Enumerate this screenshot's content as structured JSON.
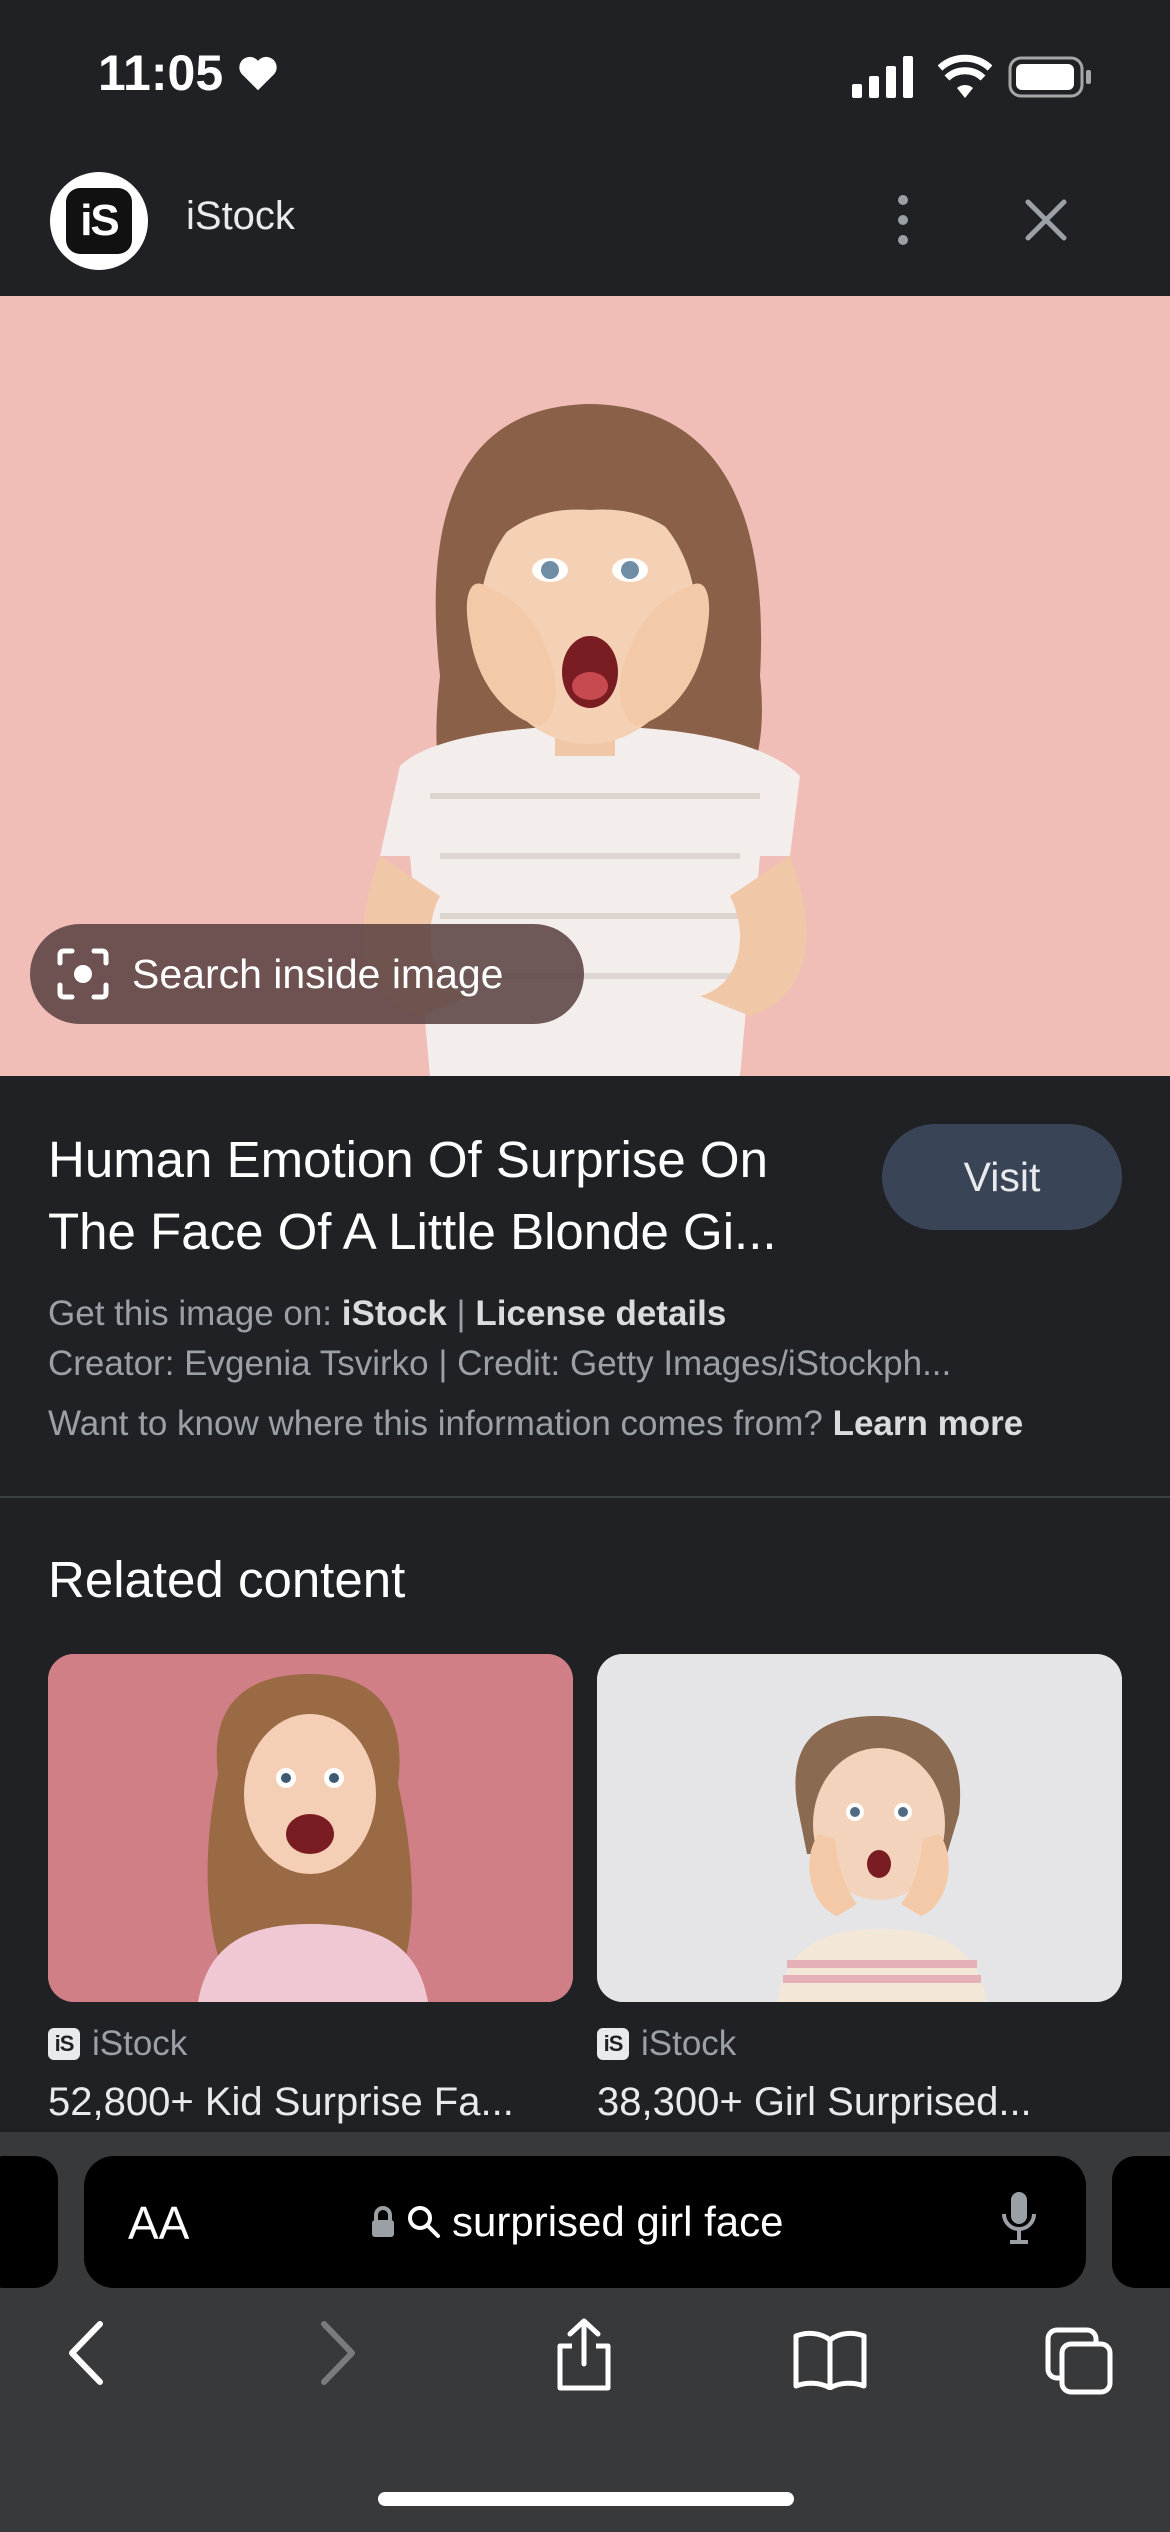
{
  "status_bar": {
    "time": "11:05"
  },
  "site": {
    "name": "iStock",
    "logo_text": "iS"
  },
  "hero": {
    "search_inside_label": "Search inside image"
  },
  "info": {
    "title": "Human Emotion Of Surprise On The Face Of A Little Blonde Gi...",
    "visit_label": "Visit",
    "get_image_prefix": "Get this image on:",
    "get_image_source": "iStock",
    "license_link": "License details",
    "creator_line": "Creator: Evgenia Tsvirko | Credit: Getty Images/iStockph...",
    "source_question": "Want to know where this information comes from?",
    "learn_more": "Learn more"
  },
  "related": {
    "heading": "Related content",
    "cards": [
      {
        "source": "iStock",
        "title": "52,800+ Kid Surprise Fa..."
      },
      {
        "source": "iStock",
        "title": "38,300+ Girl Surprised..."
      }
    ]
  },
  "browser": {
    "aa_label": "AA",
    "address": "surprised girl face"
  },
  "icons": {
    "more": "more-vert-icon",
    "close": "close-icon",
    "lens": "lens-icon",
    "lock": "lock-icon",
    "search": "search-icon",
    "mic": "mic-icon",
    "back": "back-icon",
    "forward": "forward-icon",
    "share": "share-icon",
    "bookmarks": "bookmarks-icon",
    "tabs": "tabs-icon"
  },
  "colors": {
    "background": "#202124",
    "hero_bg": "#f0bdb7",
    "visit_button": "#394457",
    "safari_toolbar": "#38393b"
  }
}
